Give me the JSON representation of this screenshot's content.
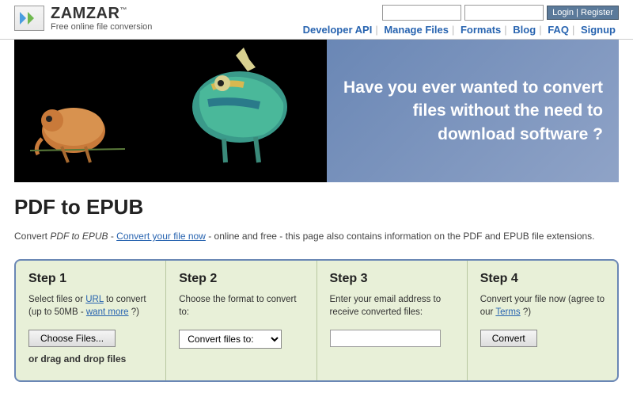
{
  "header": {
    "brand": "ZAMZAR",
    "tagline": "Free online file conversion",
    "login_label": "Login",
    "register_label": "Register",
    "nav": [
      "Developer API",
      "Manage Files",
      "Formats",
      "Blog",
      "FAQ",
      "Signup"
    ]
  },
  "hero": {
    "text": "Have you ever wanted to convert files without the need to download software ?"
  },
  "page": {
    "title": "PDF to EPUB",
    "intro_prefix": "Convert ",
    "intro_em": "PDF to EPUB",
    "intro_mid": " - ",
    "intro_link": "Convert your file now",
    "intro_suffix": " - online and free - this page also contains information on the PDF and EPUB file extensions."
  },
  "steps": {
    "s1": {
      "title": "Step 1",
      "desc_before": "Select files or ",
      "url_link": "URL",
      "desc_mid": " to convert (up to 50MB - ",
      "want_more": "want more",
      "desc_after": " ?)",
      "choose_label": "Choose Files...",
      "dnd": "or drag and drop files"
    },
    "s2": {
      "title": "Step 2",
      "desc": "Choose the format to convert to:",
      "select_label": "Convert files to:"
    },
    "s3": {
      "title": "Step 3",
      "desc": "Enter your email address to receive converted files:"
    },
    "s4": {
      "title": "Step 4",
      "desc_before": "Convert your file now (agree to our ",
      "terms_link": "Terms",
      "desc_after": " ?)",
      "convert_label": "Convert"
    }
  }
}
